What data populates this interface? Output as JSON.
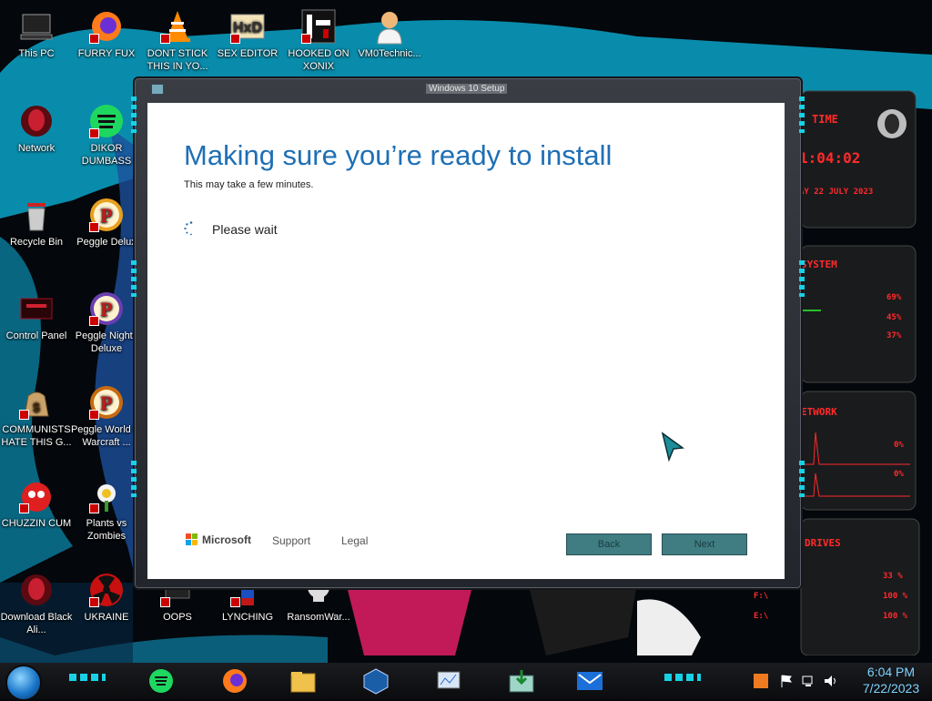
{
  "desktop": {
    "icons": [
      {
        "label": "This PC",
        "icon": "computer-icon"
      },
      {
        "label": "FURRY FUX",
        "icon": "firefox-icon"
      },
      {
        "label": "DONT STICK THIS IN YO...",
        "icon": "vlc-cone-icon"
      },
      {
        "label": "SEX EDITOR",
        "icon": "hxd-icon"
      },
      {
        "label": "HOOKED ON XONIX",
        "icon": "xonix-icon"
      },
      {
        "label": "VM0Technic...",
        "icon": "doctor-icon"
      },
      {
        "label": "Network",
        "icon": "alien-head-icon"
      },
      {
        "label": "DIKOR DUMBASS",
        "icon": "discord-icon"
      },
      {
        "label": "Recycle Bin",
        "icon": "recycle-bin-icon"
      },
      {
        "label": "Peggle Delux",
        "icon": "peggle-icon"
      },
      {
        "label": "Control Panel",
        "icon": "control-panel-icon"
      },
      {
        "label": "Peggle Nights Deluxe",
        "icon": "peggle-icon"
      },
      {
        "label": "COMMUNISTS HATE THIS G...",
        "icon": "money-bag-icon"
      },
      {
        "label": "Peggle World of Warcraft ...",
        "icon": "peggle-icon"
      },
      {
        "label": "CHUZZIN CUM",
        "icon": "chuzzle-icon"
      },
      {
        "label": "Plants vs Zombies",
        "icon": "flower-icon"
      },
      {
        "label": "Download Black Ali...",
        "icon": "alien-head-icon"
      },
      {
        "label": "UKRAINE",
        "icon": "radiation-icon"
      },
      {
        "label": "OOPS",
        "icon": "oops-icon"
      },
      {
        "label": "LYNCHING",
        "icon": "lynching-icon"
      },
      {
        "label": "RansomWar...",
        "icon": "skull-icon"
      }
    ]
  },
  "setup": {
    "window_title": "Windows 10 Setup",
    "heading": "Making sure you’re ready to install",
    "subtext": "This may take a few minutes.",
    "status": "Please wait",
    "brand": "Microsoft",
    "support_label": "Support",
    "legal_label": "Legal",
    "back_label": "Back",
    "next_label": "Next",
    "heading_color": "#1f6fb5"
  },
  "gadget": {
    "time_label": "TIME",
    "time_value": "1:04:02",
    "date_value": "AY 22 JULY 2023",
    "system_label": "SYSTEM",
    "sys_values": [
      "69%",
      "45%",
      "37%"
    ],
    "network_label": "ETWORK",
    "net_values": [
      "0%",
      "0%"
    ],
    "drives_label": "DRIVES",
    "drive_values": [
      "33 %",
      "100 %",
      "100 %"
    ],
    "drive_letters": [
      "F:\\",
      "E:\\"
    ],
    "accent_color": "#ff2a2a"
  },
  "taskbar": {
    "items": [
      {
        "icon": "spotify-icon"
      },
      {
        "icon": "firefox-icon"
      },
      {
        "icon": "file-explorer-icon"
      },
      {
        "icon": "virtualbox-icon"
      },
      {
        "icon": "system-monitor-icon"
      },
      {
        "icon": "setup-install-icon"
      },
      {
        "icon": "mail-icon"
      }
    ],
    "tray_icons": [
      "flag-icon",
      "network-icon",
      "volume-icon"
    ],
    "time": "6:04 PM",
    "date": "7/22/2023",
    "clock_color": "#7fd2ff"
  }
}
